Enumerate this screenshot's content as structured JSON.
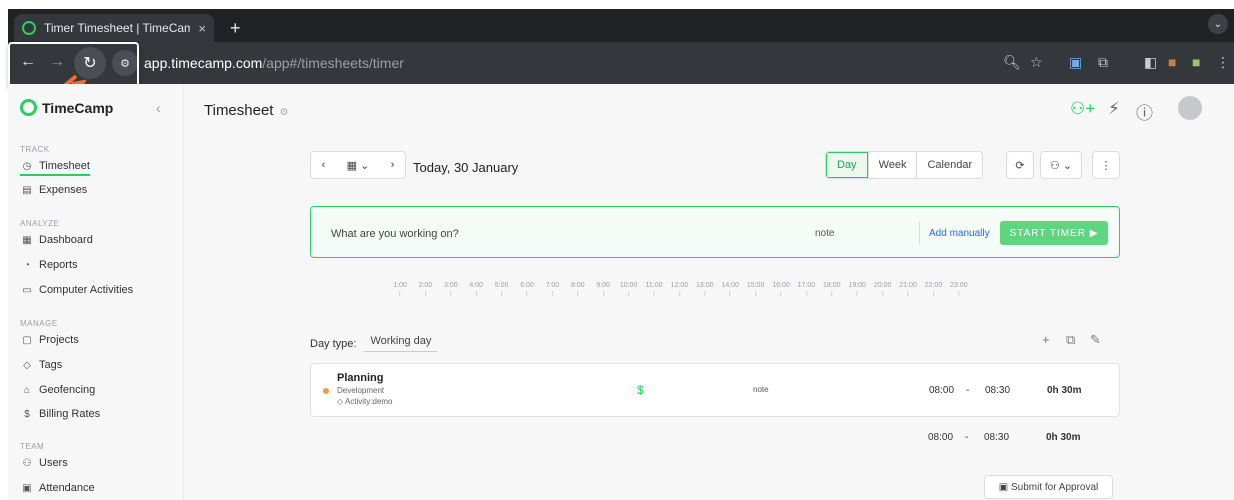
{
  "browser": {
    "tab_title": "Timer Timesheet | TimeCamp",
    "tab_close": "×",
    "new_tab": "+",
    "url_host": "app.timecamp.com",
    "url_path": "/app#/timesheets/timer"
  },
  "sidebar": {
    "logo": "TimeCamp",
    "sections": {
      "track": "TRACK",
      "analyze": "ANALYZE",
      "manage": "MANAGE",
      "team": "TEAM"
    },
    "items": {
      "timesheet": "Timesheet",
      "expenses": "Expenses",
      "dashboard": "Dashboard",
      "reports": "Reports",
      "computer_activities": "Computer Activities",
      "projects": "Projects",
      "tags": "Tags",
      "geofencing": "Geofencing",
      "billing_rates": "Billing Rates",
      "users": "Users",
      "attendance": "Attendance"
    }
  },
  "header": {
    "title": "Timesheet"
  },
  "toolbar": {
    "date": "Today, 30 January",
    "views": {
      "day": "Day",
      "week": "Week",
      "calendar": "Calendar"
    }
  },
  "timer": {
    "prompt": "What are you working on?",
    "note": "note",
    "add_manually": "Add manually",
    "start": "START TIMER"
  },
  "ruler_hours": [
    "1:00",
    "2:00",
    "3:00",
    "4:00",
    "5:00",
    "6:00",
    "7:00",
    "8:00",
    "9:00",
    "10:00",
    "11:00",
    "12:00",
    "13:00",
    "14:00",
    "15:00",
    "16:00",
    "17:00",
    "18:00",
    "19:00",
    "20:00",
    "21:00",
    "22:00",
    "23:00"
  ],
  "day_type": {
    "label": "Day type:",
    "value": "Working day"
  },
  "entry": {
    "task": "Planning",
    "project": "Development",
    "tag": "Activity:demo",
    "billable_symbol": "$",
    "note": "note",
    "start": "08:00",
    "dash": "-",
    "end": "08:30",
    "duration": "0h 30m"
  },
  "totals": {
    "start": "08:00",
    "dash": "-",
    "end": "08:30",
    "duration": "0h 30m"
  },
  "submit_label": "Submit for Approval",
  "colors": {
    "brand_green": "#25cf60",
    "annotation_arrow": "#f26b2e",
    "link_blue": "#2a6cd6"
  }
}
